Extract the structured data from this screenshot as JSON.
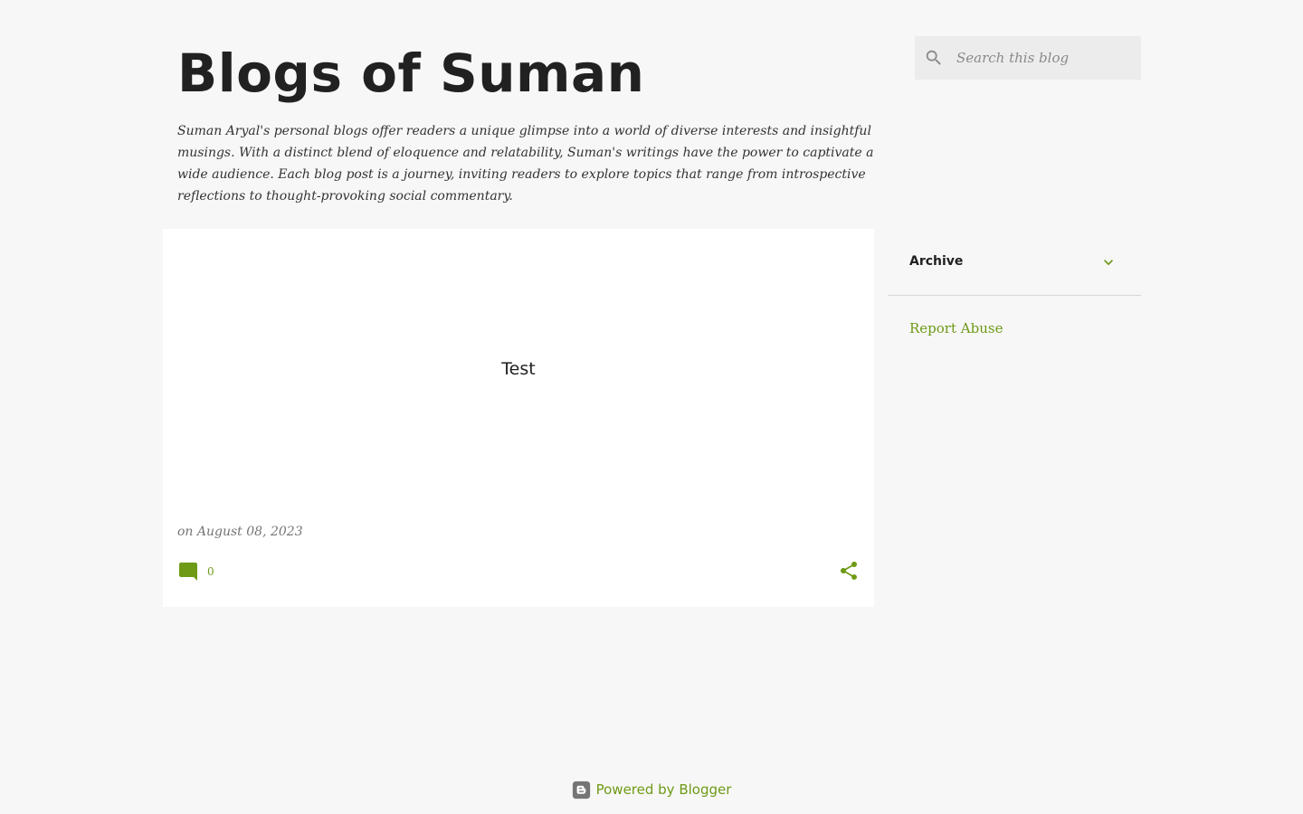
{
  "header": {
    "title": "Blogs of Suman",
    "description": "Suman Aryal's personal blogs offer readers a unique glimpse into a world of diverse interests and insightful musings. With a distinct blend of eloquence and relatability, Suman's writings have the power to captivate a wide audience. Each blog post is a journey, inviting readers to explore topics that range from introspective reflections to thought-provoking social commentary."
  },
  "search": {
    "placeholder": "Search this blog",
    "icon": "search-icon"
  },
  "post": {
    "title": "Test",
    "date": "on August 08, 2023",
    "comment_count": "0",
    "comment_icon": "comment-icon",
    "share_icon": "share-icon"
  },
  "sidebar": {
    "archive_label": "Archive",
    "archive_icon": "chevron-down-icon",
    "report_abuse_label": "Report Abuse"
  },
  "footer": {
    "powered_by": "Powered by Blogger",
    "icon": "blogger-icon"
  },
  "colors": {
    "background": "#f7f7f7",
    "card": "#ffffff",
    "accent": "#6e9a16",
    "text": "#212121",
    "muted": "#757575",
    "search_bg": "#ececec"
  }
}
